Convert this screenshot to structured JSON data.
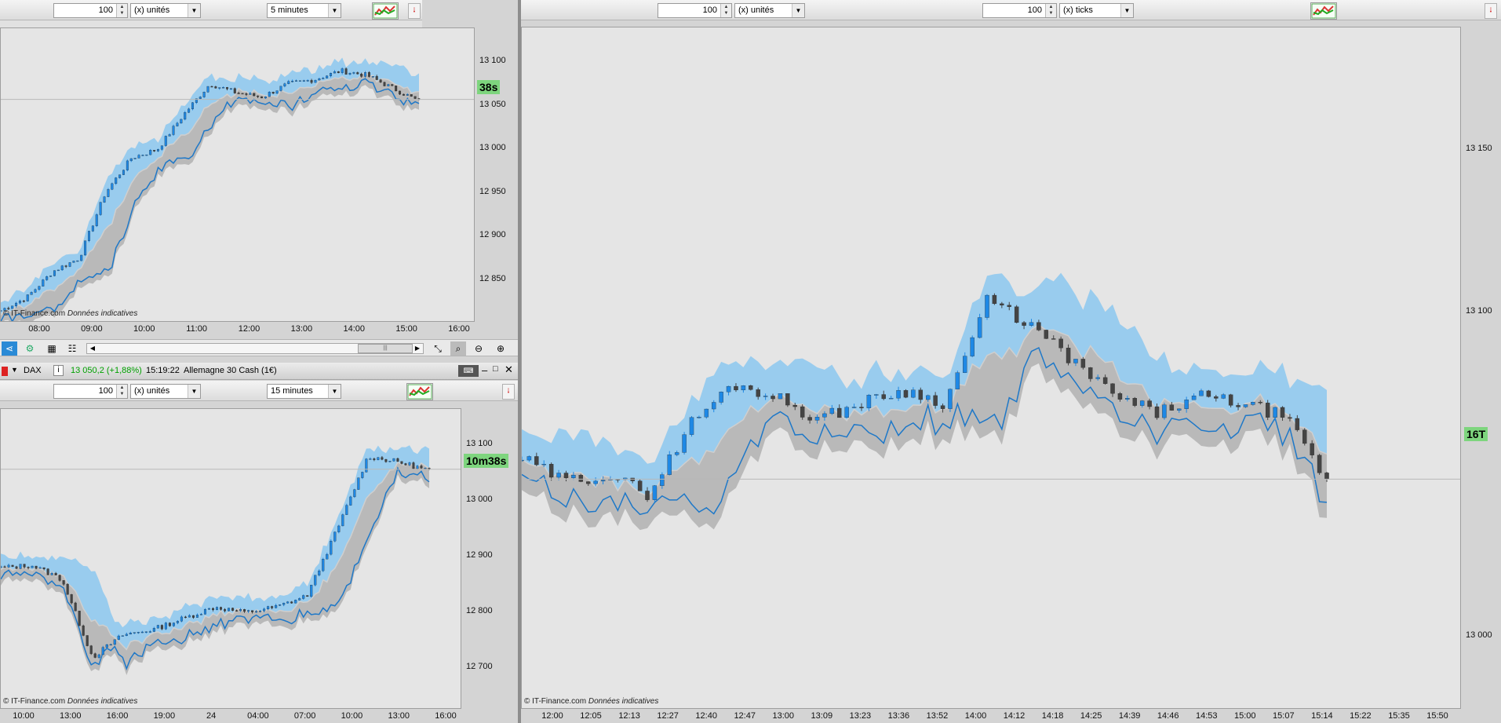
{
  "top_left": {
    "qty": "100",
    "unit_type": "(x) unités",
    "timeframe": "5 minutes",
    "timer": "38s",
    "credit_brand": "© IT-Finance.com",
    "credit_note": "Données indicatives",
    "y_labels": [
      "13 100",
      "13 050",
      "13 000",
      "12 950",
      "12 900",
      "12 850"
    ],
    "x_labels": [
      "08:00",
      "09:00",
      "10:00",
      "11:00",
      "12:00",
      "13:00",
      "14:00",
      "15:00",
      "16:00"
    ]
  },
  "instrument": {
    "symbol": "DAX",
    "price": "13 050,2 (+1,88%)",
    "time": "15:19:22",
    "name": "Allemagne 30 Cash (1€)"
  },
  "bottom_left": {
    "qty": "100",
    "unit_type": "(x) unités",
    "timeframe": "15 minutes",
    "timer": "10m38s",
    "credit_brand": "© IT-Finance.com",
    "credit_note": "Données indicatives",
    "y_labels": [
      "13 100",
      "13 000",
      "12 900",
      "12 800",
      "12 700"
    ],
    "x_labels": [
      "10:00",
      "13:00",
      "16:00",
      "19:00",
      "24",
      "04:00",
      "07:00",
      "10:00",
      "13:00",
      "16:00"
    ]
  },
  "right": {
    "qty1": "100",
    "unit_type1": "(x) unités",
    "qty2": "100",
    "unit_type2": "(x) ticks",
    "timer": "16T",
    "credit_brand": "© IT-Finance.com",
    "credit_note": "Données indicatives",
    "y_labels": [
      "13 150",
      "13 100",
      "13 000"
    ],
    "x_labels": [
      "12:00",
      "12:05",
      "12:13",
      "12:27",
      "12:40",
      "12:47",
      "13:00",
      "13:09",
      "13:23",
      "13:36",
      "13:52",
      "14:00",
      "14:12",
      "14:18",
      "14:25",
      "14:39",
      "14:46",
      "14:53",
      "15:00",
      "15:07",
      "15:14",
      "15:22",
      "15:35",
      "15:50"
    ]
  },
  "icons": {
    "pin": "pin-icon",
    "share": "share-icon",
    "indicators": "indicators-icon",
    "calc": "calculator-icon",
    "zoom_area": "zoom-area-icon",
    "zoom_out": "zoom-out-icon",
    "zoom_in": "zoom-in-icon"
  },
  "colors": {
    "candle_up": "#1e88e5",
    "candle_down": "#444444",
    "band_blue": "#8cc8f0",
    "band_gray": "#a9a9a9",
    "timer_bg": "#7ed57e",
    "price_up": "#00a000"
  },
  "chart_data": [
    {
      "type": "line",
      "panel": "top-left",
      "ylim": [
        12810,
        13110
      ],
      "x_ticks": [
        "08:00",
        "09:00",
        "10:00",
        "11:00",
        "12:00",
        "13:00",
        "14:00",
        "15:00",
        "16:00"
      ],
      "series": [
        {
          "values": [
            12815,
            12830,
            12860,
            12875,
            12950,
            12990,
            13000,
            13040,
            13075,
            13065,
            13060,
            13075,
            13080,
            13090,
            13085,
            13070,
            13055
          ]
        }
      ]
    },
    {
      "type": "line",
      "panel": "bottom-left",
      "ylim": [
        12640,
        13120
      ],
      "x_ticks": [
        "10:00",
        "13:00",
        "16:00",
        "19:00",
        "24",
        "04:00",
        "07:00",
        "10:00",
        "13:00",
        "16:00"
      ],
      "series": [
        {
          "values": [
            12880,
            12885,
            12860,
            12720,
            12760,
            12770,
            12790,
            12810,
            12800,
            12810,
            12830,
            12950,
            13080,
            13070,
            13055
          ]
        }
      ]
    },
    {
      "type": "line",
      "panel": "right",
      "ylim": [
        12980,
        13180
      ],
      "x_ticks": [
        "12:00",
        "12:05",
        "12:13",
        "12:27",
        "12:40",
        "12:47",
        "13:00",
        "13:09",
        "13:23",
        "13:36",
        "13:52",
        "14:00",
        "14:12",
        "14:18",
        "14:25",
        "14:39",
        "14:46",
        "14:53",
        "15:00",
        "15:07",
        "15:14",
        "15:22",
        "15:35",
        "15:50"
      ],
      "series": [
        {
          "values": [
            13055,
            13048,
            13050,
            13044,
            13066,
            13078,
            13074,
            13067,
            13072,
            13076,
            13072,
            13104,
            13096,
            13085,
            13074,
            13069,
            13074,
            13072,
            13068,
            13048
          ]
        }
      ]
    }
  ]
}
